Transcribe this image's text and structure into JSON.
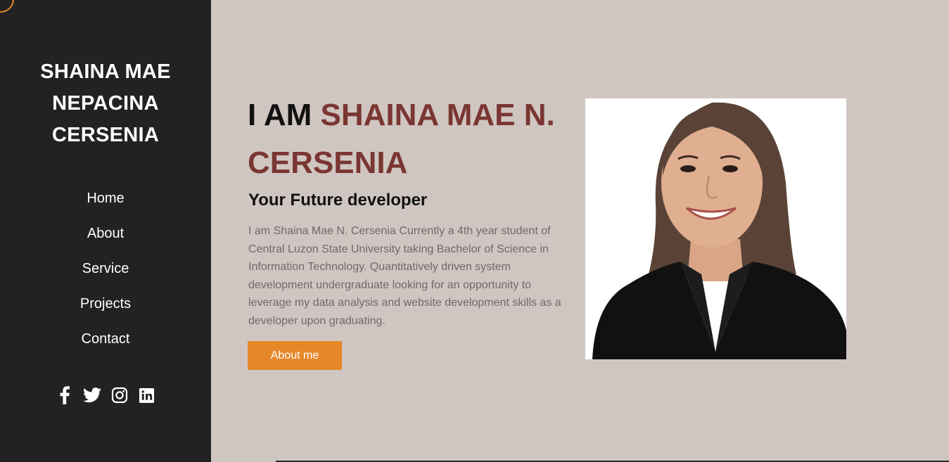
{
  "sidebar": {
    "brand_lines": [
      "SHAINA MAE",
      "NEPACINA",
      "CERSENIA"
    ],
    "nav": [
      {
        "label": "Home"
      },
      {
        "label": "About"
      },
      {
        "label": "Service"
      },
      {
        "label": "Projects"
      },
      {
        "label": "Contact"
      }
    ],
    "social_icons": [
      "facebook-icon",
      "twitter-icon",
      "instagram-icon",
      "linkedin-icon"
    ]
  },
  "hero": {
    "intro": "I AM ",
    "name": "SHAINA MAE N. CERSENIA",
    "subtitle": "Your Future developer",
    "bio": "I am Shaina Mae N. Cersenia Currently a 4th year student of Central Luzon State University taking Bachelor of Science in Information Technology. Quantitatively driven system development undergraduate looking for an opportunity to leverage my data analysis and website development skills as a developer upon graduating.",
    "button_label": "About me"
  },
  "colors": {
    "sidebar_bg": "#222222",
    "page_bg": "#d0c6c1",
    "accent_name": "#7a3632",
    "button": "#e6882a"
  }
}
